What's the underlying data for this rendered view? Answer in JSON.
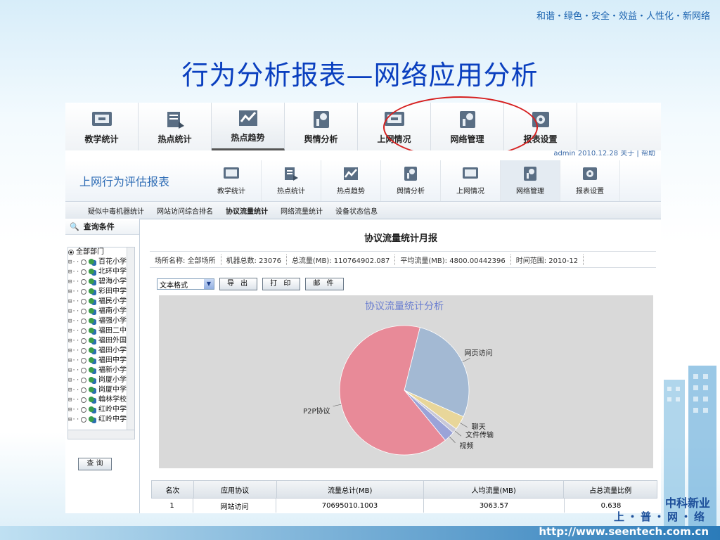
{
  "slogan": "和谐・绿色・安全・效益・人性化・新网络",
  "slide_title": "行为分析报表—网络应用分析",
  "top_toolbar": [
    "教学统计",
    "热点统计",
    "热点趋势",
    "舆情分析",
    "上网情况",
    "网络管理",
    "报表设置"
  ],
  "app": {
    "userbar": "admin  2010.12.28  关于 | 帮助",
    "brand": "上网行为评估报表",
    "nav": [
      "教学统计",
      "热点统计",
      "热点趋势",
      "舆情分析",
      "上网情况",
      "网络管理",
      "报表设置"
    ],
    "subnav": [
      "疑似中毒机器统计",
      "网站访问综合排名",
      "协议流量统计",
      "网络流量统计",
      "设备状态信息"
    ],
    "sidebar": {
      "header": "查询条件",
      "root": "全部部门",
      "items": [
        "百花小学",
        "北环中学",
        "碧海小学",
        "彩田中学",
        "福民小学",
        "福南小学",
        "福强小学",
        "福田二中",
        "福田外国",
        "福田小学",
        "福田中学",
        "福新小学",
        "岗厦小学",
        "岗厦中学",
        "翰林学校",
        "红岭中学",
        "红岭中学"
      ],
      "query_button": "查 询"
    },
    "report": {
      "title": "协议流量统计月报",
      "info": [
        {
          "label": "场所名称:",
          "value": "全部场所"
        },
        {
          "label": "机器总数:",
          "value": "23076"
        },
        {
          "label": "总流量(MB):",
          "value": "110764902.087"
        },
        {
          "label": "平均流量(MB):",
          "value": "4800.00442396"
        },
        {
          "label": "时间范围:",
          "value": "2010-12"
        }
      ],
      "format_select": "文本格式",
      "buttons": [
        "导 出",
        "打 印",
        "邮 件"
      ]
    },
    "table": {
      "headers": [
        "名次",
        "应用协议",
        "流量总计(MB)",
        "人均流量(MB)",
        "占总流量比例"
      ],
      "rows": [
        [
          "1",
          "网站访问",
          "70695010.1003",
          "3063.57",
          "0.638"
        ]
      ]
    }
  },
  "chart_data": {
    "type": "pie",
    "title": "协议流量统计分析",
    "labels": [
      "网页访问",
      "聊天",
      "文件传输",
      "视频",
      "P2P协议"
    ],
    "values": [
      0.278,
      0.035,
      0.012,
      0.027,
      0.648
    ],
    "colors": [
      "#a3b9d3",
      "#e8d69a",
      "#c8c8d8",
      "#9aa3d8",
      "#e88a98"
    ]
  },
  "footer": {
    "company": "中科新业",
    "tagline": "上・普・网・络",
    "url": "http://www.seentech.com.cn"
  }
}
